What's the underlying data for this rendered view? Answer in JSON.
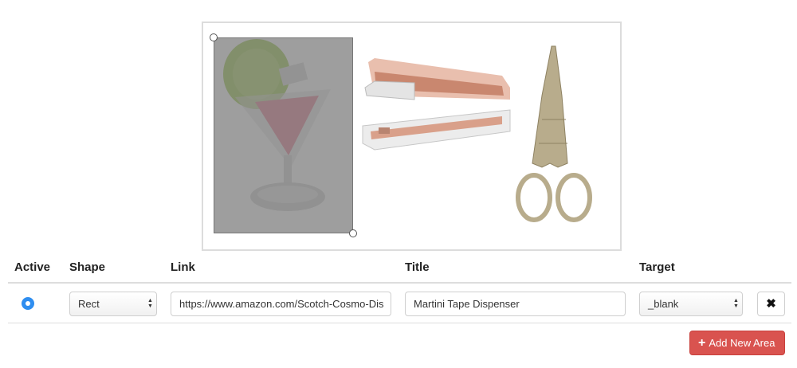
{
  "table": {
    "headers": {
      "active": "Active",
      "shape": "Shape",
      "link": "Link",
      "title": "Title",
      "target": "Target"
    },
    "row": {
      "active": true,
      "shape": "Rect",
      "link": "https://www.amazon.com/Scotch-Cosmo-Dis",
      "title": "Martini Tape Dispenser",
      "target": "_blank"
    }
  },
  "buttons": {
    "delete_icon": "✖",
    "add_icon": "+",
    "add_label": "Add New Area"
  },
  "icons": {
    "delete": "close-icon",
    "add": "plus-icon",
    "select_arrows": "chevron-updown-icon"
  },
  "colors": {
    "radio": "#2f8ef0",
    "add_button": "#d9534f",
    "selection_overlay": "#787878"
  }
}
